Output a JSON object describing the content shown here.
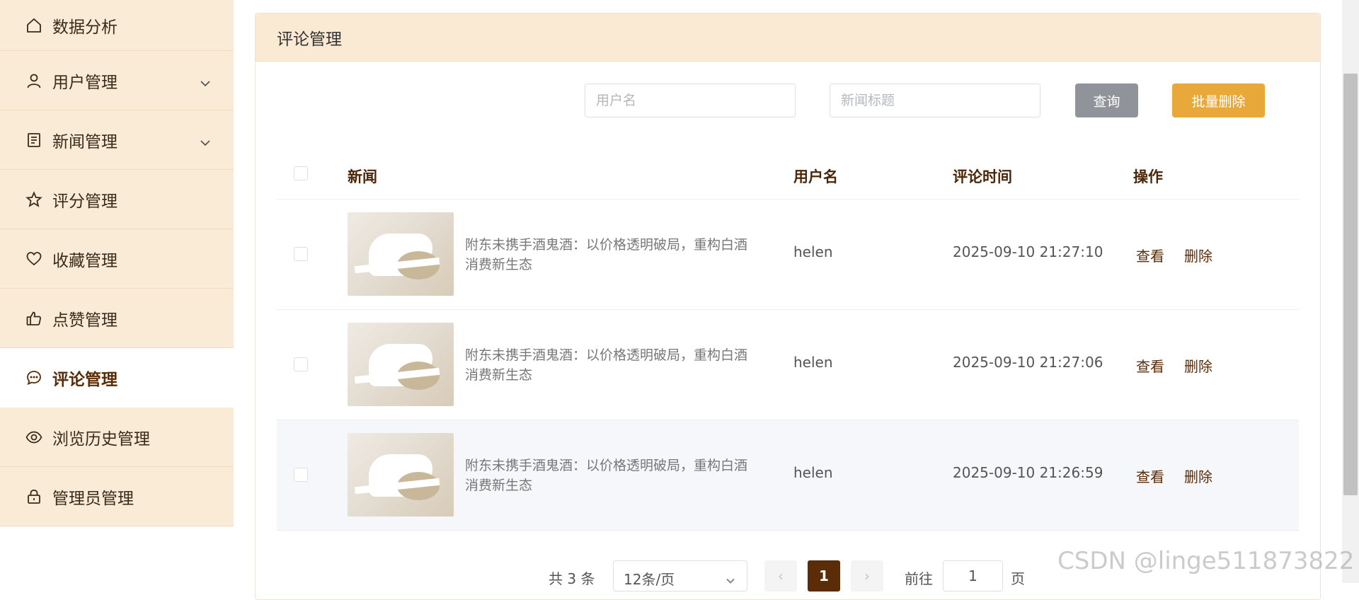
{
  "sidebar": {
    "items": [
      {
        "label": "数据分析",
        "icon": "home-icon"
      },
      {
        "label": "用户管理",
        "icon": "user-icon",
        "expandable": true
      },
      {
        "label": "新闻管理",
        "icon": "document-icon",
        "expandable": true
      },
      {
        "label": "评分管理",
        "icon": "star-icon"
      },
      {
        "label": "收藏管理",
        "icon": "heart-icon"
      },
      {
        "label": "点赞管理",
        "icon": "thumbs-up-icon"
      },
      {
        "label": "评论管理",
        "icon": "comment-icon",
        "active": true
      },
      {
        "label": "浏览历史管理",
        "icon": "eye-icon"
      },
      {
        "label": "管理员管理",
        "icon": "lock-icon"
      }
    ]
  },
  "panel": {
    "title": "评论管理"
  },
  "search": {
    "username_placeholder": "用户名",
    "news_title_placeholder": "新闻标题",
    "query_label": "查询",
    "batch_delete_label": "批量删除"
  },
  "table": {
    "headers": {
      "news": "新闻",
      "username": "用户名",
      "comment_time": "评论时间",
      "actions": "操作"
    },
    "rows": [
      {
        "news_title": "附东未携手酒鬼酒：以价格透明破局，重构白酒消费新生态",
        "username": "helen",
        "time": "2025-09-10 21:27:10",
        "view": "查看",
        "delete": "删除"
      },
      {
        "news_title": "附东未携手酒鬼酒：以价格透明破局，重构白酒消费新生态",
        "username": "helen",
        "time": "2025-09-10 21:27:06",
        "view": "查看",
        "delete": "删除"
      },
      {
        "news_title": "附东未携手酒鬼酒：以价格透明破局，重构白酒消费新生态",
        "username": "helen",
        "time": "2025-09-10 21:26:59",
        "view": "查看",
        "delete": "删除"
      }
    ]
  },
  "pagination": {
    "total": "共 3 条",
    "page_size": "12条/页",
    "current_page": "1",
    "goto_label": "前往",
    "goto_value": "1",
    "page_unit": "页"
  },
  "watermark": "CSDN @linge511873822",
  "colors": {
    "sidebar_bg": "#faebd7",
    "accent_brown": "#5a2c08",
    "batch_delete": "#e8a93a",
    "query_button": "#909399"
  }
}
